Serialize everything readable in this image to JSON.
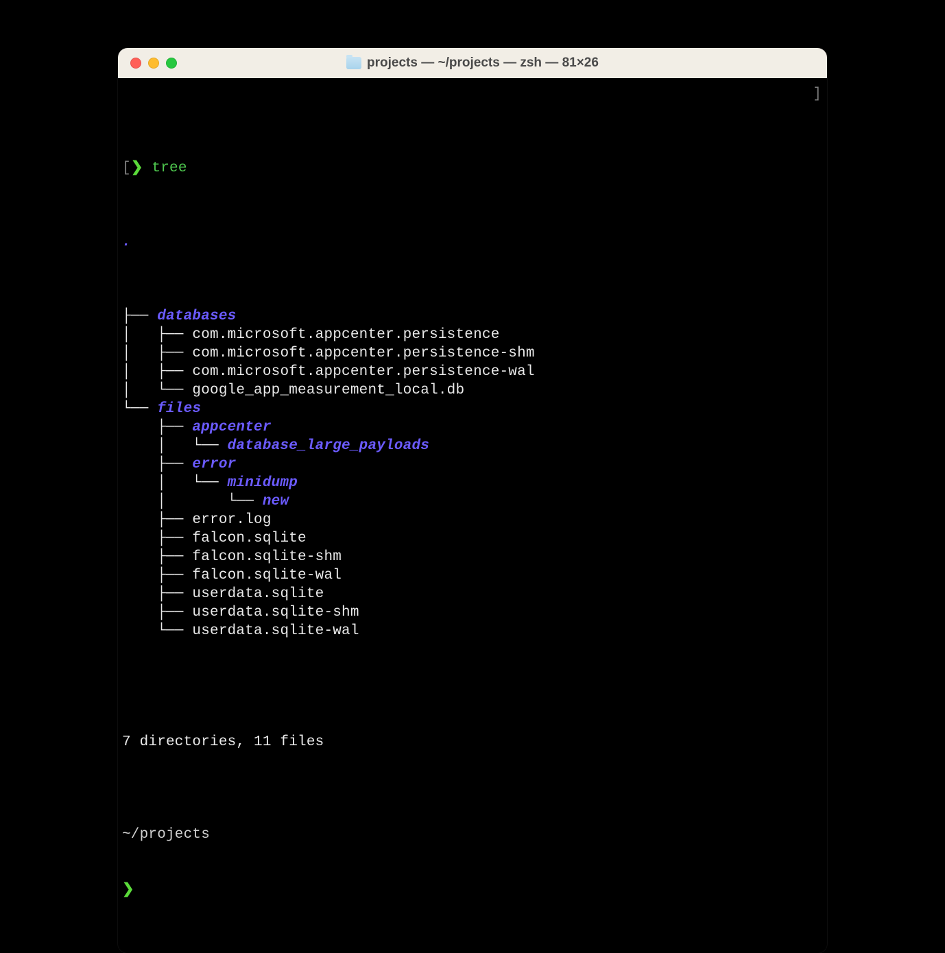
{
  "window": {
    "title": "projects — ~/projects — zsh — 81×26"
  },
  "prompt": {
    "open_bracket": "[",
    "close_bracket": "]",
    "symbol": "❯",
    "command": "tree"
  },
  "tree": {
    "root": ".",
    "lines": [
      {
        "prefix": "├── ",
        "name": "databases",
        "type": "dir"
      },
      {
        "prefix": "│   ├── ",
        "name": "com.microsoft.appcenter.persistence",
        "type": "file"
      },
      {
        "prefix": "│   ├── ",
        "name": "com.microsoft.appcenter.persistence-shm",
        "type": "file"
      },
      {
        "prefix": "│   ├── ",
        "name": "com.microsoft.appcenter.persistence-wal",
        "type": "file"
      },
      {
        "prefix": "│   └── ",
        "name": "google_app_measurement_local.db",
        "type": "file"
      },
      {
        "prefix": "└── ",
        "name": "files",
        "type": "dir"
      },
      {
        "prefix": "    ├── ",
        "name": "appcenter",
        "type": "dir"
      },
      {
        "prefix": "    │   └── ",
        "name": "database_large_payloads",
        "type": "dir"
      },
      {
        "prefix": "    ├── ",
        "name": "error",
        "type": "dir"
      },
      {
        "prefix": "    │   └── ",
        "name": "minidump",
        "type": "dir"
      },
      {
        "prefix": "    │       └── ",
        "name": "new",
        "type": "dir"
      },
      {
        "prefix": "    ├── ",
        "name": "error.log",
        "type": "file"
      },
      {
        "prefix": "    ├── ",
        "name": "falcon.sqlite",
        "type": "file"
      },
      {
        "prefix": "    ├── ",
        "name": "falcon.sqlite-shm",
        "type": "file"
      },
      {
        "prefix": "    ├── ",
        "name": "falcon.sqlite-wal",
        "type": "file"
      },
      {
        "prefix": "    ├── ",
        "name": "userdata.sqlite",
        "type": "file"
      },
      {
        "prefix": "    ├── ",
        "name": "userdata.sqlite-shm",
        "type": "file"
      },
      {
        "prefix": "    └── ",
        "name": "userdata.sqlite-wal",
        "type": "file"
      }
    ]
  },
  "summary": "7 directories, 11 files",
  "cwd": "~/projects",
  "next_prompt": "❯"
}
